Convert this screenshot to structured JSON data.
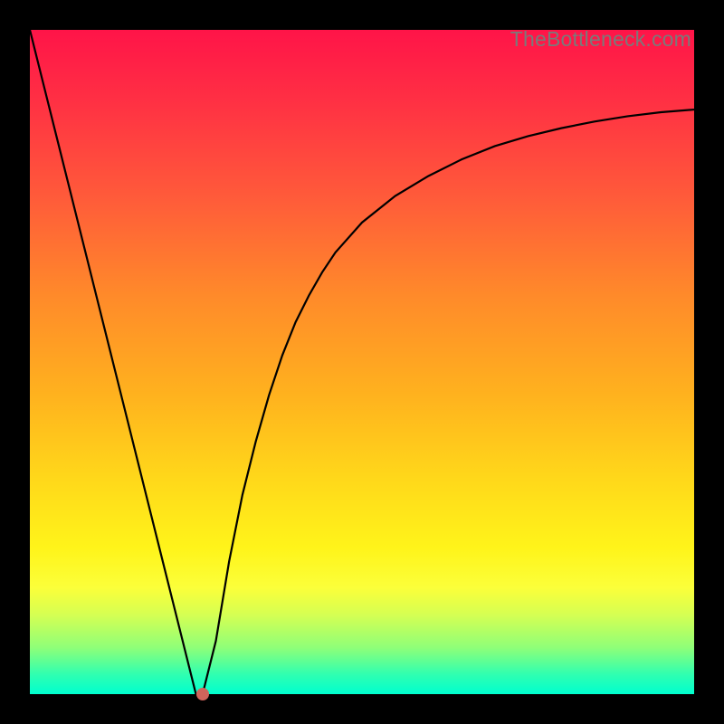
{
  "watermark": "TheBottleneck.com",
  "colors": {
    "frame": "#000000",
    "gradient_top": "#ff1448",
    "gradient_bottom": "#00ffcf",
    "curve": "#000000",
    "marker": "#d1645b"
  },
  "chart_data": {
    "type": "line",
    "title": "",
    "xlabel": "",
    "ylabel": "",
    "xlim": [
      0,
      100
    ],
    "ylim": [
      0,
      100
    ],
    "x": [
      0,
      2,
      4,
      6,
      8,
      10,
      12,
      14,
      16,
      18,
      20,
      22,
      24,
      25,
      26,
      28,
      30,
      32,
      34,
      36,
      38,
      40,
      42,
      44,
      46,
      50,
      55,
      60,
      65,
      70,
      75,
      80,
      85,
      90,
      95,
      100
    ],
    "values": [
      100,
      92,
      84,
      76,
      68,
      60,
      52,
      44,
      36,
      28,
      20,
      12,
      4,
      0,
      0,
      8,
      20,
      30,
      38,
      45,
      51,
      56,
      60,
      63.5,
      66.5,
      71,
      75,
      78,
      80.5,
      82.5,
      84,
      85.2,
      86.2,
      87,
      87.6,
      88
    ],
    "marker": {
      "x": 26,
      "y": 0
    },
    "background_gradient": {
      "direction": "vertical",
      "stops": [
        {
          "pos": 0.0,
          "color": "#ff1448"
        },
        {
          "pos": 0.4,
          "color": "#ff8a2a"
        },
        {
          "pos": 0.78,
          "color": "#fff41a"
        },
        {
          "pos": 1.0,
          "color": "#00ffcf"
        }
      ]
    }
  }
}
